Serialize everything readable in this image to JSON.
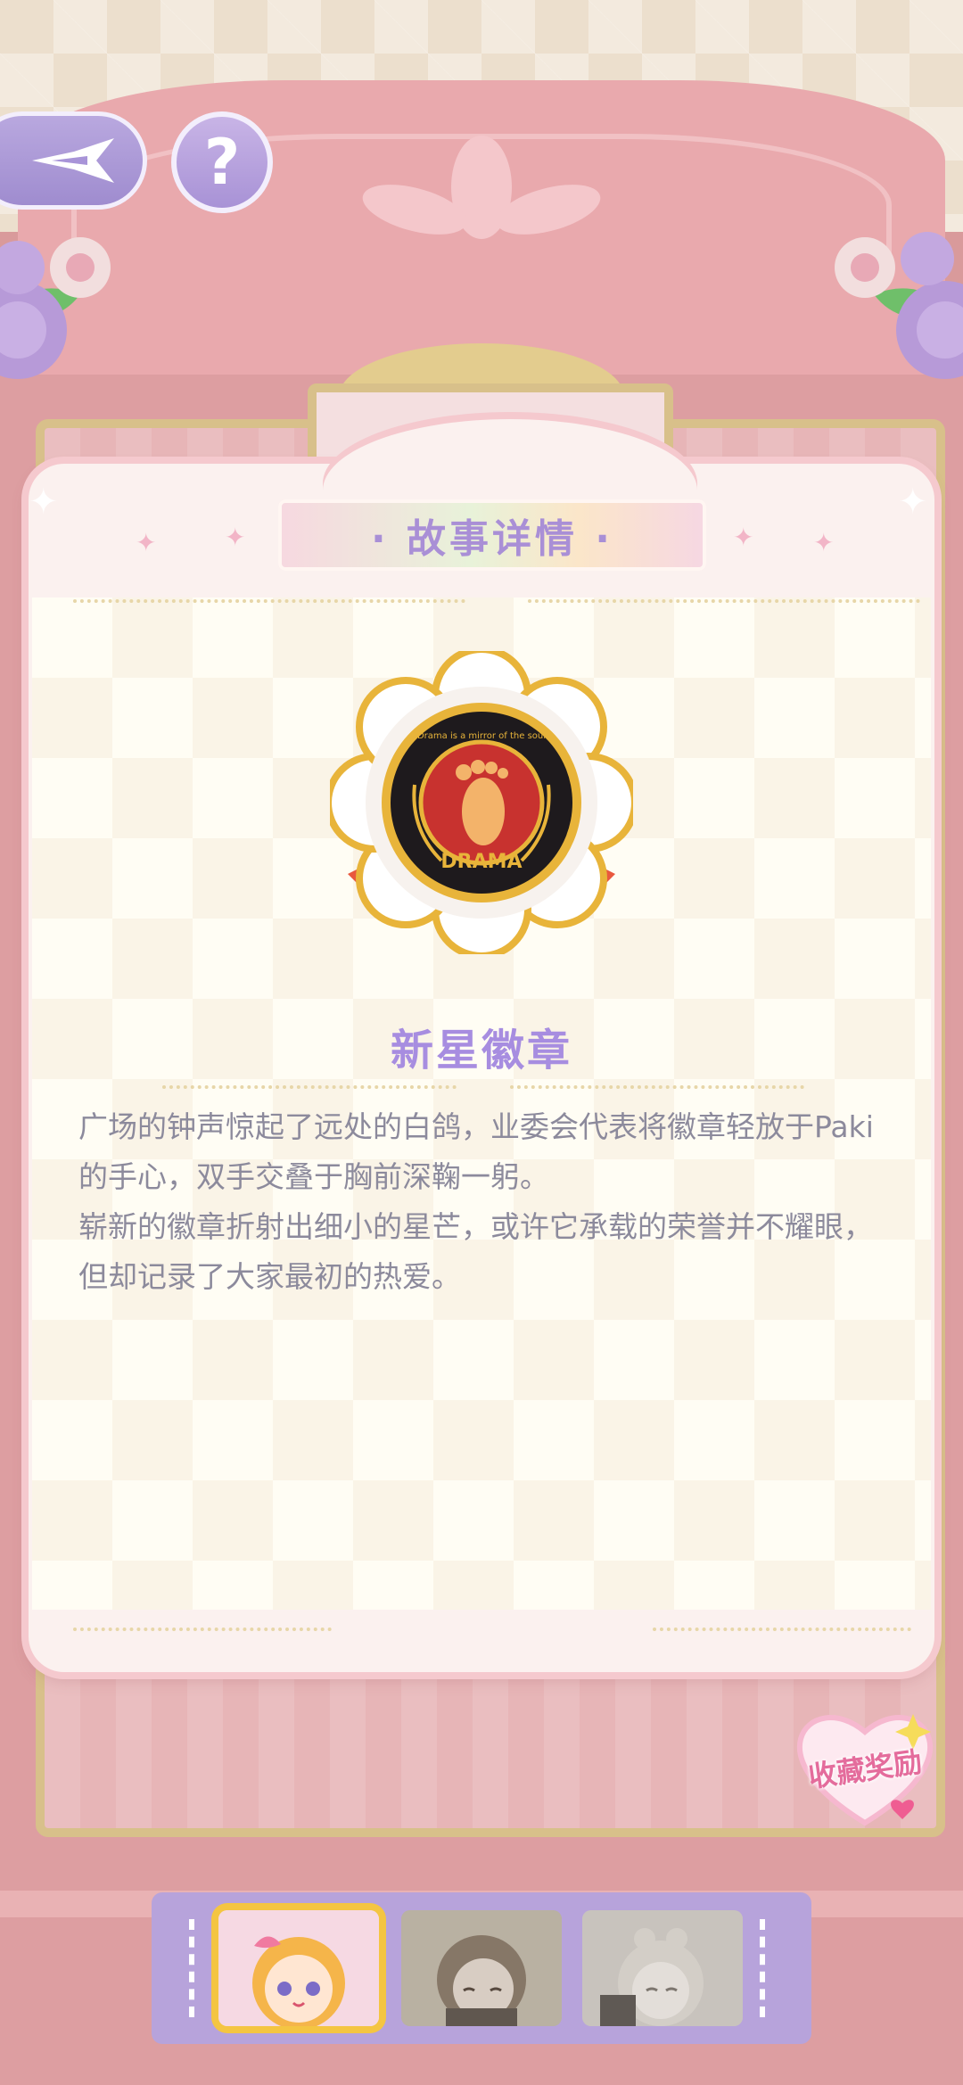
{
  "header": {
    "back_icon": "compass-arrow-icon",
    "help_label": "?"
  },
  "card": {
    "title": "· 故事详情 ·",
    "badge": {
      "name": "新星徽章",
      "motto": "Drama is a mirror of the soul",
      "emblem_text": "DRAMA",
      "icon": "footprint-icon"
    },
    "description": [
      "广场的钟声惊起了远处的白鸽，业委会代表将徽章轻放于Paki的手心，双手交叠于胸前深鞠一躬。",
      "崭新的徽章折射出细小的星芒，或许它承载的荣誉并不耀眼，但却记录了大家最初的热爱。"
    ]
  },
  "reward": {
    "label": "收藏奖励"
  },
  "characters": [
    {
      "id": "char-1",
      "selected": true
    },
    {
      "id": "char-2",
      "selected": false
    },
    {
      "id": "char-3",
      "selected": false
    }
  ],
  "colors": {
    "accent_purple": "#a78de0",
    "badge_gold": "#e8b43a",
    "badge_red": "#c8322f",
    "wardrobe_pink": "#dd9ea1"
  }
}
